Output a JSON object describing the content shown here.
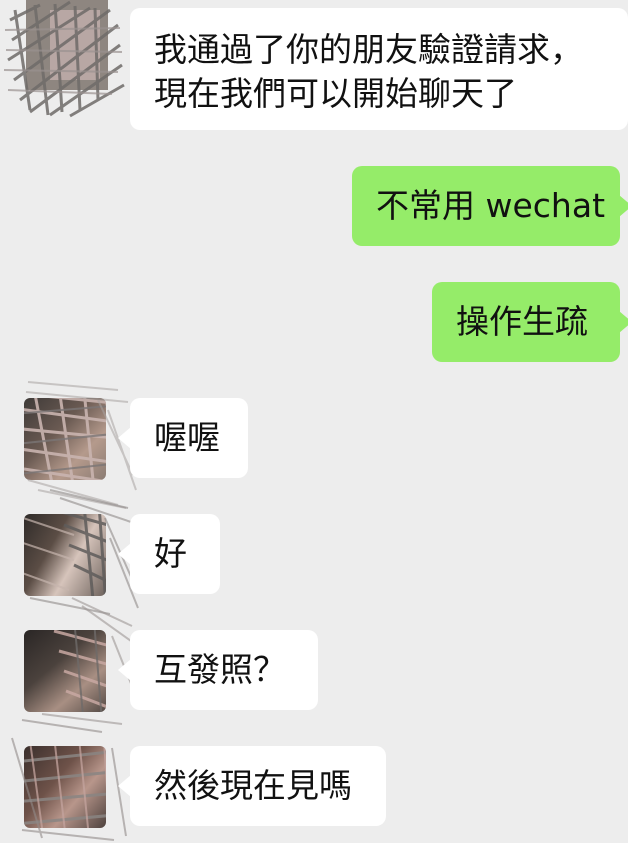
{
  "chat": {
    "messages": [
      {
        "side": "in",
        "lines": [
          "我通過了你的朋友驗證請求，",
          "現在我們可以開始聊天了"
        ]
      },
      {
        "side": "out",
        "lines": [
          "不常用 wechat"
        ]
      },
      {
        "side": "out",
        "lines": [
          "操作生疏"
        ]
      },
      {
        "side": "in",
        "lines": [
          "喔喔"
        ]
      },
      {
        "side": "in",
        "lines": [
          "好"
        ]
      },
      {
        "side": "in",
        "lines": [
          "互發照？"
        ]
      },
      {
        "side": "in",
        "lines": [
          "然後現在見嗎"
        ]
      }
    ]
  },
  "colors": {
    "background": "#ededed",
    "incoming_bubble": "#ffffff",
    "outgoing_bubble": "#95ec69"
  },
  "icons": {
    "contact_avatar": "avatar-redacted-scribble"
  }
}
